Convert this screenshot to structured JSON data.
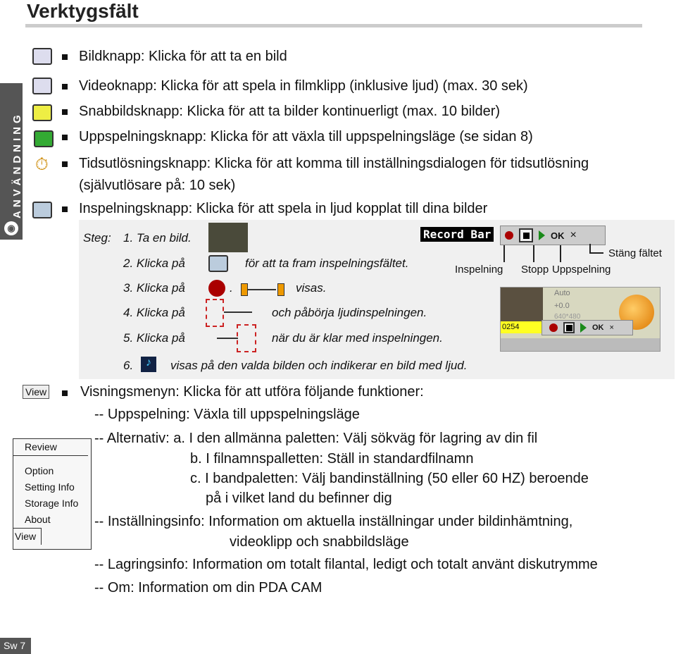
{
  "title": "Verktygsfält",
  "side_tab": "ANVÄNDNING",
  "items": [
    "Bildknapp: Klicka för att ta en bild",
    "Videoknapp: Klicka för att spela in filmklipp (inklusive ljud) (max. 30 sek)",
    "Snabbildsknapp: Klicka för att ta bilder kontinuerligt (max. 10 bilder)",
    "Uppspelningsknapp: Klicka för att växla till uppspelningsläge (se sidan 8)",
    "Tidsutlösningsknapp: Klicka för att komma till inställningsdialogen för tidsutlösning",
    "(självutlösare på: 10 sek)",
    "Inspelningsknapp: Klicka för att spela in ljud kopplat till dina bilder"
  ],
  "steps": {
    "label": "Steg:",
    "s1": "1. Ta en bild.",
    "s2a": "2. Klicka på",
    "s2b": "för att ta fram inspelningsfältet.",
    "s3a": "3. Klicka på",
    "s3b": ".",
    "s3c": "visas.",
    "s4a": "4. Klicka på",
    "s4b": "och påbörja ljudinspelningen.",
    "s5a": "5. Klicka på",
    "s5b": "när du är klar med inspelningen.",
    "s6a": "6.",
    "s6b": "visas på den valda bilden och indikerar en bild med ljud."
  },
  "record_bar": {
    "label": "Record Bar",
    "ok": "OK",
    "close": "×",
    "close_label": "Stäng fältet",
    "rec_label": "Inspelning",
    "stop_label": "Stopp",
    "play_label": "Uppspelning",
    "counter": "0254",
    "awb": "Auto",
    "ev": "+0.0",
    "res": "640*480"
  },
  "view": {
    "button": "View",
    "intro": "Visningsmenyn:   Klicka för att utföra följande funktioner:",
    "lines": [
      "-- Uppspelning: Växla till uppspelningsläge",
      "-- Alternativ: a. I den allmänna paletten: Välj sökväg för lagring av din fil",
      "b. I filnamnspalletten: Ställ in standardfilnamn",
      "c. I bandpaletten: Välj bandinställning (50 eller 60 HZ) beroende",
      "på i vilket land du befinner dig",
      "-- Inställningsinfo: Information om aktuella inställningar under bildinhämtning,",
      "videoklipp och snabbildsläge",
      "-- Lagringsinfo:  Information om totalt filantal, ledigt och totalt använt diskutrymme",
      "-- Om:  Information om din PDA CAM"
    ],
    "menu": [
      "Review",
      "Option",
      "Setting Info",
      "Storage Info",
      "About",
      "View"
    ]
  },
  "footer": "Sw 7"
}
